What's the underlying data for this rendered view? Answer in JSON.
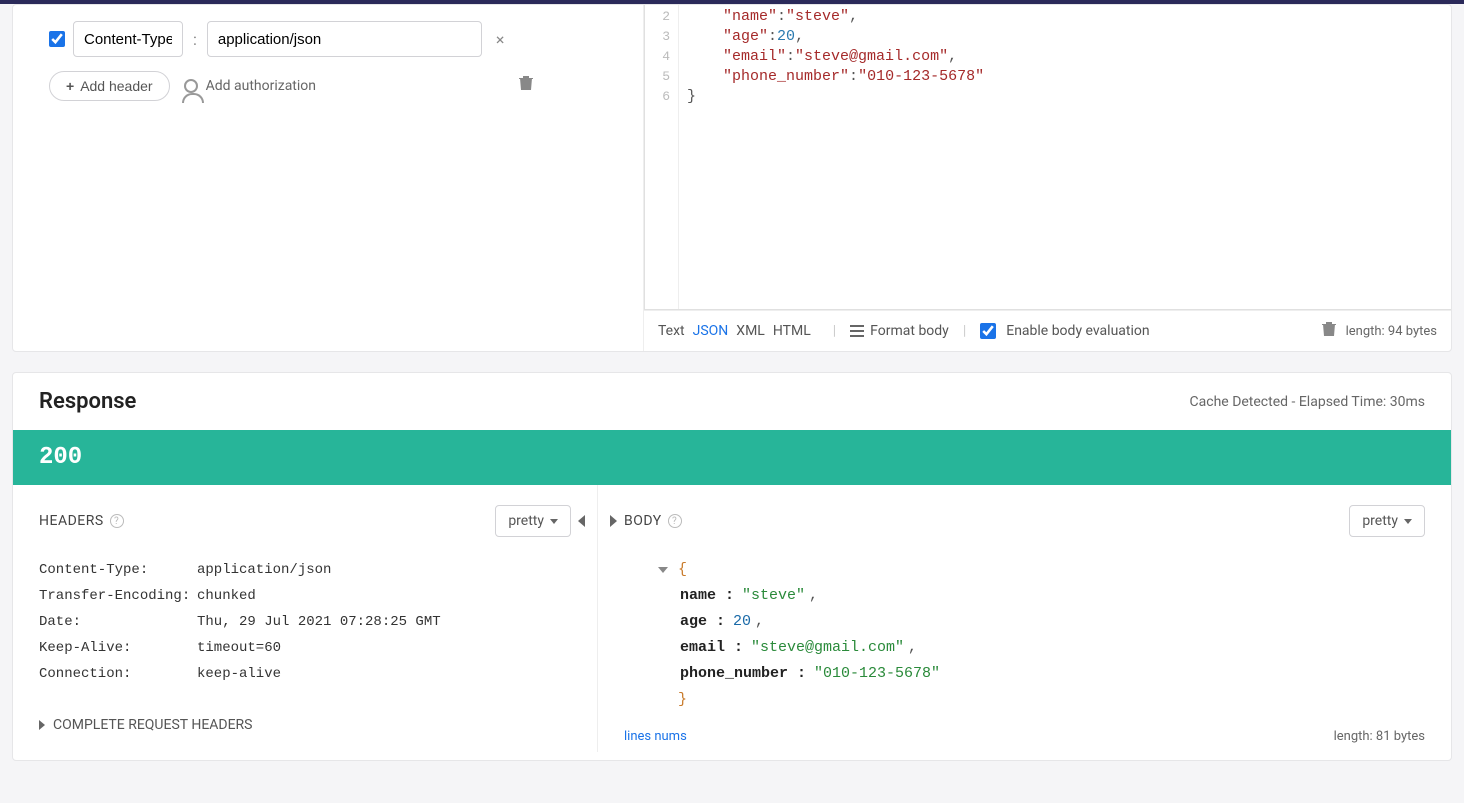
{
  "request": {
    "headers": [
      {
        "enabled": true,
        "name": "Content-Type",
        "value": "application/json"
      }
    ],
    "addHeaderLabel": "Add header",
    "addAuthLabel": "Add authorization"
  },
  "requestBody": {
    "lines": [
      [
        {
          "t": "key",
          "v": "\"name\""
        },
        {
          "t": "punc",
          "v": ":"
        },
        {
          "t": "str",
          "v": "\"steve\""
        },
        {
          "t": "punc",
          "v": ","
        }
      ],
      [
        {
          "t": "key",
          "v": "\"age\""
        },
        {
          "t": "punc",
          "v": ":"
        },
        {
          "t": "num",
          "v": "20"
        },
        {
          "t": "punc",
          "v": ","
        }
      ],
      [
        {
          "t": "key",
          "v": "\"email\""
        },
        {
          "t": "punc",
          "v": ":"
        },
        {
          "t": "str",
          "v": "\"steve@gmail.com\""
        },
        {
          "t": "punc",
          "v": ","
        }
      ],
      [
        {
          "t": "key",
          "v": "\"phone_number\""
        },
        {
          "t": "punc",
          "v": ":"
        },
        {
          "t": "str",
          "v": "\"010-123-5678\""
        }
      ],
      [
        {
          "t": "punc",
          "v": "}"
        }
      ]
    ],
    "lineStart": 2,
    "toolbar": {
      "tabs": [
        "Text",
        "JSON",
        "XML",
        "HTML"
      ],
      "activeTab": "JSON",
      "formatLabel": "Format body",
      "evalLabel": "Enable body evaluation",
      "evalChecked": true,
      "lengthLabel": "length: 94 bytes"
    }
  },
  "response": {
    "title": "Response",
    "meta": "Cache Detected - Elapsed Time: 30ms",
    "status": "200",
    "headers": {
      "title": "HEADERS",
      "viewMode": "pretty",
      "rows": [
        {
          "k": "Content-Type:",
          "v": "application/json"
        },
        {
          "k": "Transfer-Encoding:",
          "v": "chunked"
        },
        {
          "k": "Date:",
          "v": "Thu, 29 Jul 2021 07:28:25 GMT"
        },
        {
          "k": "Keep-Alive:",
          "v": "timeout=60"
        },
        {
          "k": "Connection:",
          "v": "keep-alive"
        }
      ],
      "completeLabel": "COMPLETE REQUEST HEADERS"
    },
    "body": {
      "title": "BODY",
      "viewMode": "pretty",
      "json": [
        {
          "k": "name",
          "type": "str",
          "v": "\"steve\"",
          "trail": ","
        },
        {
          "k": "age",
          "type": "num",
          "v": "20",
          "trail": ","
        },
        {
          "k": "email",
          "type": "str",
          "v": "\"steve@gmail.com\"",
          "trail": ","
        },
        {
          "k": "phone_number",
          "type": "str",
          "v": "\"010-123-5678\"",
          "trail": ""
        }
      ],
      "linesNumsLabel": "lines nums",
      "lengthLabel": "length: 81 bytes"
    }
  }
}
